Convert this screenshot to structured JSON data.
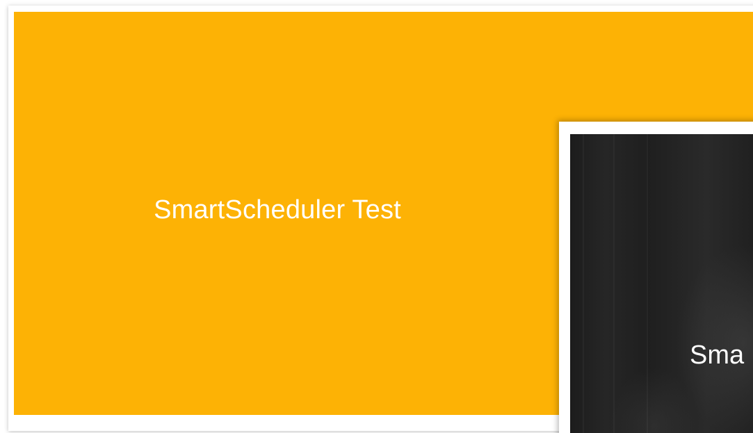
{
  "slides": [
    {
      "title": "SmartScheduler Test",
      "background": "#fdb205",
      "text_color": "#ffffff"
    },
    {
      "title": "Sma",
      "background": "#1f1f1f",
      "text_color": "#ffffff"
    }
  ]
}
